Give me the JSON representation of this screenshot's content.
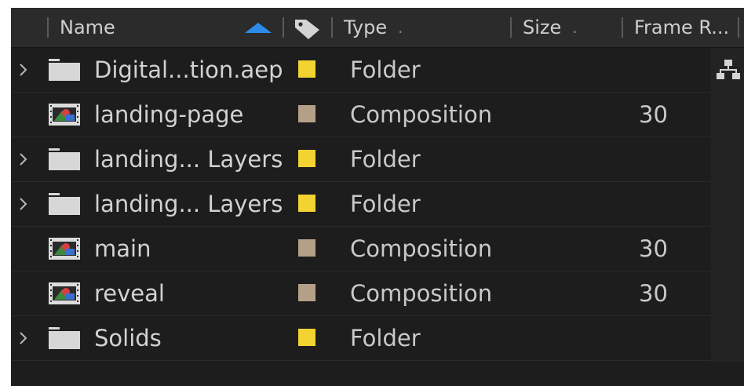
{
  "header": {
    "columns": {
      "name": "Name",
      "type": "Type",
      "size": "Size",
      "frame_rate": "Frame R..."
    },
    "sort_direction": "ascending",
    "label_column_icon": "tag-icon",
    "accent_color": "#2d8ceb"
  },
  "colors": {
    "folder_label": "#f2d332",
    "composition_label": "#b4a088",
    "panel_background": "#1d1d1d",
    "header_background": "#2b2b2b"
  },
  "rows": [
    {
      "icon": "folder-icon",
      "expandable": true,
      "name": "Digital...tion.aep",
      "label_color": "#f2d332",
      "type": "Folder",
      "frame_rate": ""
    },
    {
      "icon": "composition-icon",
      "expandable": false,
      "name": "landing-page",
      "label_color": "#b4a088",
      "type": "Composition",
      "frame_rate": "30"
    },
    {
      "icon": "folder-icon",
      "expandable": true,
      "name": "landing... Layers",
      "label_color": "#f2d332",
      "type": "Folder",
      "frame_rate": ""
    },
    {
      "icon": "folder-icon",
      "expandable": true,
      "name": "landing... Layers",
      "label_color": "#f2d332",
      "type": "Folder",
      "frame_rate": ""
    },
    {
      "icon": "composition-icon",
      "expandable": false,
      "name": "main",
      "label_color": "#b4a088",
      "type": "Composition",
      "frame_rate": "30"
    },
    {
      "icon": "composition-icon",
      "expandable": false,
      "name": "reveal",
      "label_color": "#b4a088",
      "type": "Composition",
      "frame_rate": "30"
    },
    {
      "icon": "folder-icon",
      "expandable": true,
      "name": "Solids",
      "label_color": "#f2d332",
      "type": "Folder",
      "frame_rate": ""
    }
  ],
  "side_icon": "flowchart-icon"
}
